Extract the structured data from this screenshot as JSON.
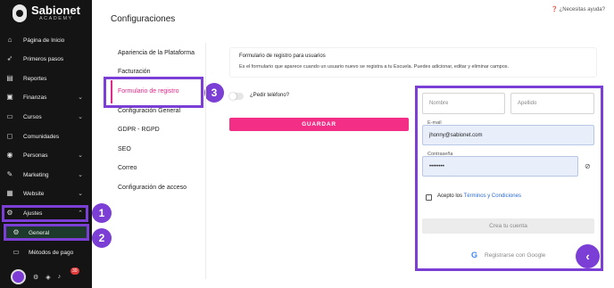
{
  "brand": {
    "name": "Sabionet",
    "subtitle": "ACADEMY"
  },
  "sidebar": {
    "items": [
      {
        "label": "Página de Inicio",
        "icon": "home-icon"
      },
      {
        "label": "Primeros pasos",
        "icon": "rocket-icon"
      },
      {
        "label": "Reportes",
        "icon": "chart-icon"
      },
      {
        "label": "Finanzas",
        "icon": "wallet-icon"
      },
      {
        "label": "Cursos",
        "icon": "book-icon"
      },
      {
        "label": "Comunidades",
        "icon": "chat-icon"
      },
      {
        "label": "Personas",
        "icon": "people-icon"
      },
      {
        "label": "Marketing",
        "icon": "megaphone-icon"
      },
      {
        "label": "Website",
        "icon": "grid-icon"
      },
      {
        "label": "Ajustes",
        "icon": "gear-icon"
      },
      {
        "label": "General",
        "icon": "sliders-icon"
      },
      {
        "label": "Métodos de pago",
        "icon": "card-icon"
      }
    ],
    "notification_count": "30"
  },
  "header": {
    "title": "Configuraciones",
    "help": "¿Necesitas ayuda?"
  },
  "settings_menu": [
    "Apariencia de la Plataforma",
    "Facturación",
    "Formulario de registro",
    "Configuración General",
    "GDPR - RGPD",
    "SEO",
    "Correo",
    "Configuración de acceso"
  ],
  "steps": [
    "1",
    "2",
    "3"
  ],
  "form_section": {
    "title": "Formulario de registro para usuarios",
    "description": "Es el formulario que aparece cuando un usuario nuevo se registra a tu Escuela. Puedes adicionar, editar y eliminar campos.",
    "toggle_label": "¿Pedir teléfono?",
    "save_label": "GUARDAR"
  },
  "preview": {
    "first_name_placeholder": "Nombre",
    "last_name_placeholder": "Apellido",
    "email_label": "E-mail",
    "email_value": "jhonny@sabionet.com",
    "password_label": "Contraseña",
    "password_value": "••••••••",
    "terms_prefix": "Acepto los",
    "terms_link": "Términos y Condiciones",
    "create_label": "Crea tu cuenta",
    "google_label": "Registrarse con Google"
  },
  "colors": {
    "accent": "#f22e86",
    "annotation": "#7b3fd6",
    "sidebar": "#141414"
  }
}
